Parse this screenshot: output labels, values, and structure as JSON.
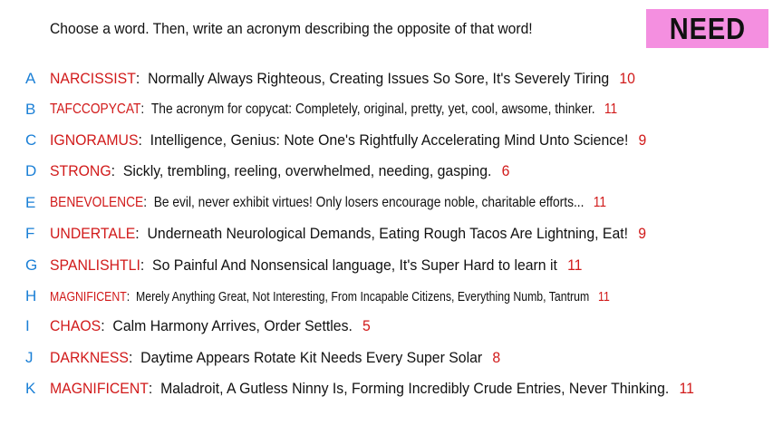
{
  "header": {
    "prompt": "Choose a word. Then, write an acronym describing the opposite of that word!",
    "badge": "NEED"
  },
  "colors": {
    "letter": "#1a7fd6",
    "word": "#d11a1a",
    "count": "#d11a1a",
    "badge_bg": "#f48fe0"
  },
  "answers": [
    {
      "letter": "A",
      "word": "NARCISSIST",
      "acronym": "Normally Always Righteous, Creating Issues So Sore, It's Severely Tiring",
      "count": "10"
    },
    {
      "letter": "B",
      "word": "TAFCCOPYCAT",
      "acronym": "The acronym for copycat: Completely, original, pretty, yet, cool, awsome, thinker.",
      "count": "11"
    },
    {
      "letter": "C",
      "word": "IGNORAMUS",
      "acronym": "Intelligence, Genius: Note One's Rightfully Accelerating Mind Unto Science!",
      "count": "9"
    },
    {
      "letter": "D",
      "word": "STRONG",
      "acronym": "Sickly, trembling, reeling, overwhelmed, needing, gasping.",
      "count": "6"
    },
    {
      "letter": "E",
      "word": "BENEVOLENCE",
      "acronym": "Be evil, never exhibit virtues! Only losers encourage noble, charitable efforts...",
      "count": "11"
    },
    {
      "letter": "F",
      "word": "UNDERTALE",
      "acronym": "Underneath Neurological Demands, Eating Rough Tacos Are Lightning, Eat!",
      "count": "9"
    },
    {
      "letter": "G",
      "word": "SPANLISHTLI",
      "acronym": "So Painful And Nonsensical language, It's Super Hard to learn it",
      "count": "11"
    },
    {
      "letter": "H",
      "word": "MAGNIFICENT",
      "acronym": "Merely Anything Great, Not Interesting, From Incapable Citizens, Everything Numb, Tantrum",
      "count": "11"
    },
    {
      "letter": "I",
      "word": "CHAOS",
      "acronym": "Calm Harmony Arrives, Order Settles.",
      "count": "5"
    },
    {
      "letter": "J",
      "word": "DARKNESS",
      "acronym": "Daytime Appears Rotate Kit Needs Every Super Solar",
      "count": "8"
    },
    {
      "letter": "K",
      "word": "MAGNIFICENT",
      "acronym": "Maladroit, A Gutless Ninny Is, Forming Incredibly Crude Entries, Never Thinking.",
      "count": "11"
    }
  ]
}
